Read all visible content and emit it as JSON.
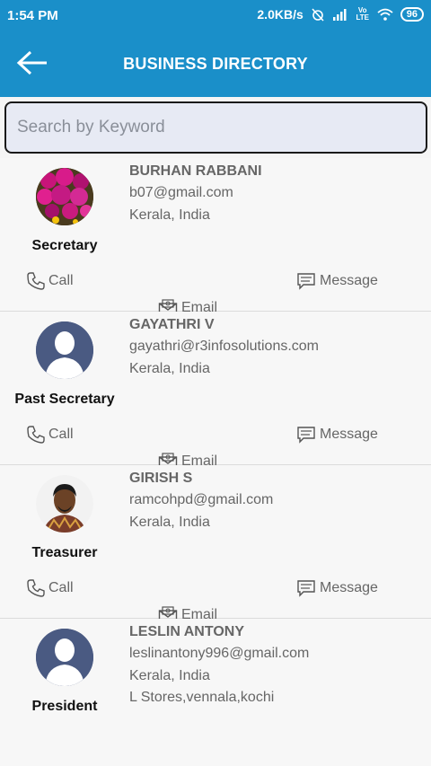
{
  "status": {
    "time": "1:54 PM",
    "speed": "2.0KB/s",
    "battery": "96",
    "lte": "Vo LTE"
  },
  "header": {
    "title": "BUSINESS DIRECTORY"
  },
  "search": {
    "placeholder": "Search by Keyword"
  },
  "actions": {
    "call": "Call",
    "email": "Email",
    "message": "Message"
  },
  "members": [
    {
      "name": "BURHAN RABBANI",
      "email": "b07@gmail.com",
      "location": "Kerala, India",
      "role": "Secretary",
      "avatar": "flowers-photo"
    },
    {
      "name": "GAYATHRI V",
      "email": "gayathri@r3infosolutions.com",
      "location": "Kerala, India",
      "role": "Past Secretary",
      "avatar": "default-person-icon"
    },
    {
      "name": "GIRISH S",
      "email": "ramcohpd@gmail.com",
      "location": "Kerala, India",
      "role": "Treasurer",
      "avatar": "person-photo"
    },
    {
      "name": "LESLIN ANTONY",
      "email": "leslinantony996@gmail.com",
      "location": "Kerala, India",
      "extra": "L Stores,vennala,kochi",
      "role": "President",
      "avatar": "default-person-icon"
    }
  ]
}
